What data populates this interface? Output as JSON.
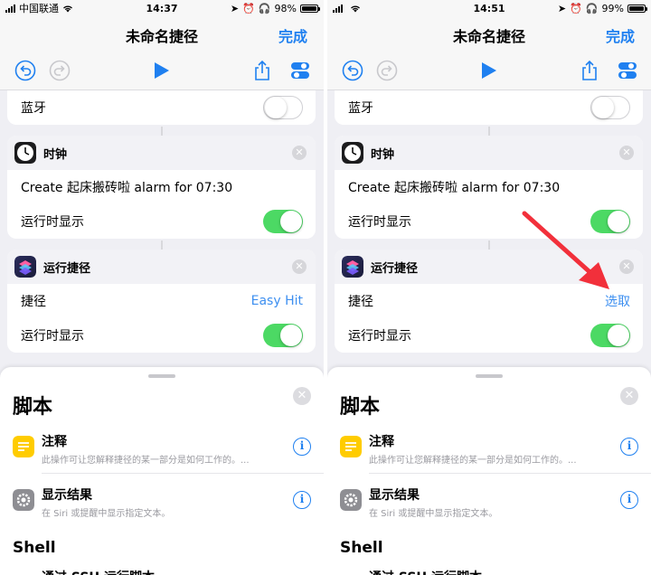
{
  "panels": [
    {
      "status": {
        "carrier": "中国联通",
        "time": "14:37",
        "battery": "98%",
        "battery_level": 0.98
      },
      "nav": {
        "title": "未命名捷径",
        "done": "完成"
      },
      "bluetooth": {
        "label": "蓝牙",
        "on": false
      },
      "clock": {
        "title": "时钟",
        "text": "Create 起床搬砖啦 alarm for 07:30",
        "show_label": "运行时显示",
        "show_on": true
      },
      "run": {
        "title": "运行捷径",
        "field_label": "捷径",
        "field_value": "Easy Hit",
        "show_label": "运行时显示",
        "show_on": true
      },
      "sheet": {
        "title": "脚本",
        "items": [
          {
            "title": "注释",
            "subtitle": "此操作可让您解释捷径的某一部分是如何工作的。...",
            "icon": "notes-icon"
          },
          {
            "title": "显示结果",
            "subtitle": "在 Siri 或提醒中显示指定文本。",
            "icon": "gear-icon"
          }
        ],
        "section": "Shell",
        "cut_item": "通过 SSH 运行脚本"
      }
    },
    {
      "status": {
        "carrier": "",
        "time": "14:51",
        "battery": "99%",
        "battery_level": 0.99
      },
      "nav": {
        "title": "未命名捷径",
        "done": "完成"
      },
      "bluetooth": {
        "label": "蓝牙",
        "on": false
      },
      "clock": {
        "title": "时钟",
        "text": "Create 起床搬砖啦 alarm for 07:30",
        "show_label": "运行时显示",
        "show_on": true
      },
      "run": {
        "title": "运行捷径",
        "field_label": "捷径",
        "field_value": "选取",
        "show_label": "运行时显示",
        "show_on": true
      },
      "sheet": {
        "title": "脚本",
        "items": [
          {
            "title": "注释",
            "subtitle": "此操作可让您解释捷径的某一部分是如何工作的。...",
            "icon": "notes-icon"
          },
          {
            "title": "显示结果",
            "subtitle": "在 Siri 或提醒中显示指定文本。",
            "icon": "gear-icon"
          }
        ],
        "section": "Shell",
        "cut_item": "通过 SSH 运行脚本"
      }
    }
  ],
  "colors": {
    "accent": "#1f80f0",
    "toggle_on": "#4cd964",
    "arrow": "#f2303b"
  }
}
